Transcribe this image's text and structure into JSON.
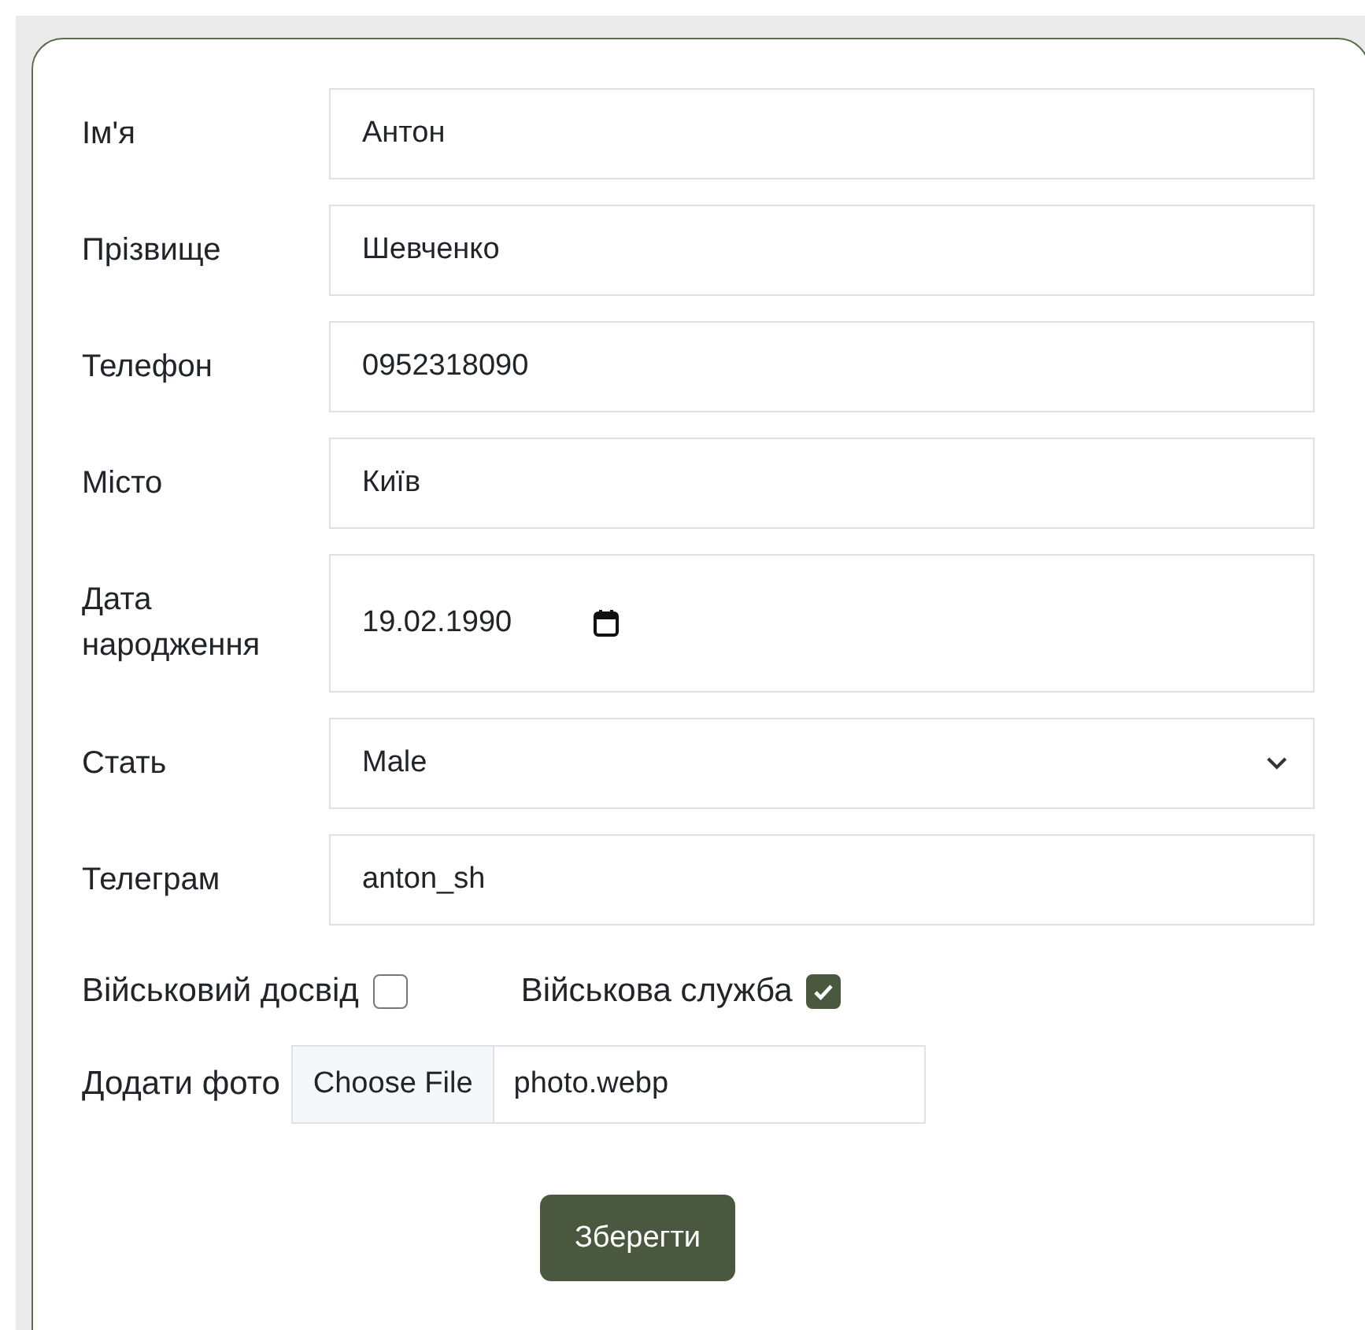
{
  "fields": [
    {
      "kind": "text",
      "label": "Ім'я",
      "value": "Антон"
    },
    {
      "kind": "text",
      "label": "Прізвище",
      "value": "Шевченко"
    },
    {
      "kind": "text",
      "label": "Телефон",
      "value": "0952318090"
    },
    {
      "kind": "text",
      "label": "Місто",
      "value": "Київ"
    },
    {
      "kind": "date",
      "label": "Дата народження",
      "value": "19.02.1990"
    },
    {
      "kind": "select",
      "label": "Стать",
      "value": "Male"
    },
    {
      "kind": "text",
      "label": "Телеграм",
      "value": "anton_sh"
    }
  ],
  "checkboxes": [
    {
      "label": "Військовий досвід",
      "checked": false
    },
    {
      "label": "Військова служба",
      "checked": true
    }
  ],
  "photo": {
    "label": "Додати фото",
    "button": "Choose File",
    "filename": "photo.webp"
  },
  "submit": "Зберегти"
}
